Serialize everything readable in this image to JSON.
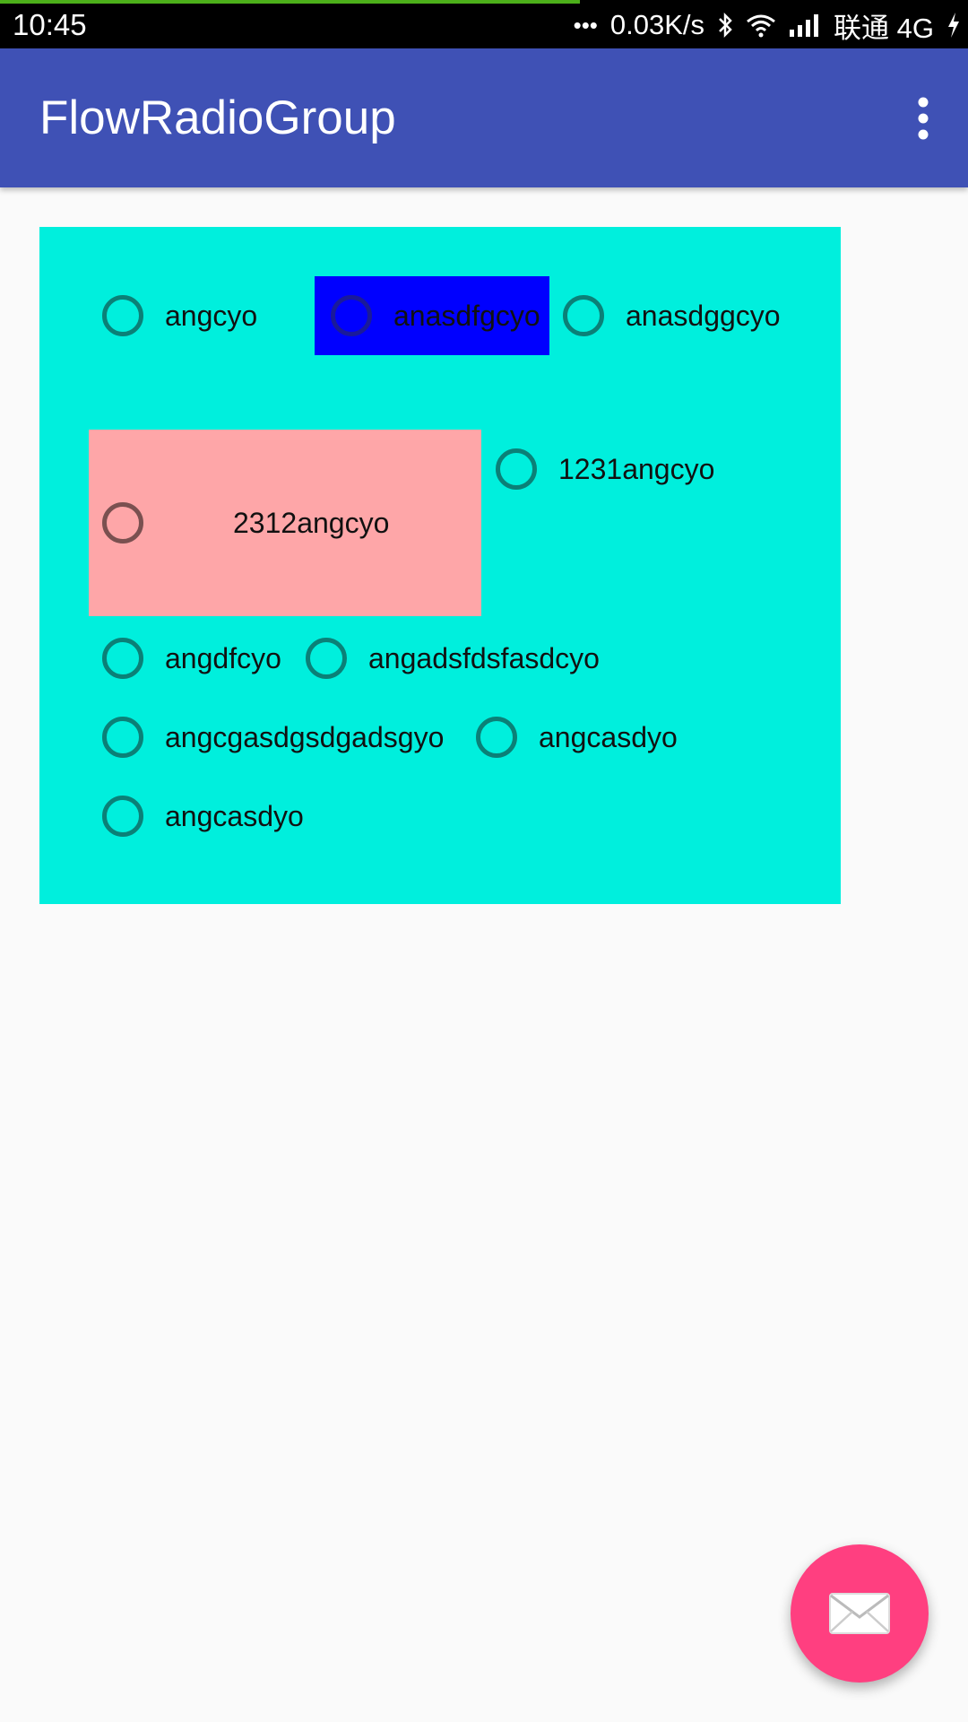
{
  "status_bar": {
    "time": "10:45",
    "more": "•••",
    "speed": "0.03K/s",
    "carrier": "联通 4G",
    "icons": [
      "bluetooth-icon",
      "wifi-icon",
      "signal-icon",
      "charging-icon"
    ]
  },
  "app_bar": {
    "title": "FlowRadioGroup",
    "menu_icon": "more-vert-icon"
  },
  "radio_group": {
    "items": [
      {
        "label": "angcyo"
      },
      {
        "label": "anasdfgcyo"
      },
      {
        "label": "anasdggcyo"
      },
      {
        "label": "2312angcyo"
      },
      {
        "label": "1231angcyo"
      },
      {
        "label": "angdfcyo"
      },
      {
        "label": "angadsfdsfasdcyo"
      },
      {
        "label": "angcgasdgsdgadsgyo"
      },
      {
        "label": "angcasdyo"
      },
      {
        "label": "angcasdyo"
      }
    ]
  },
  "fab": {
    "icon": "mail-icon"
  },
  "colors": {
    "app_bar": "#3f51b5",
    "group_background": "#00efdd",
    "blue_item": "#0000ff",
    "pink_item": "#fea6a8",
    "fab": "#ff3f80",
    "radio_stroke": "#0b8077"
  }
}
